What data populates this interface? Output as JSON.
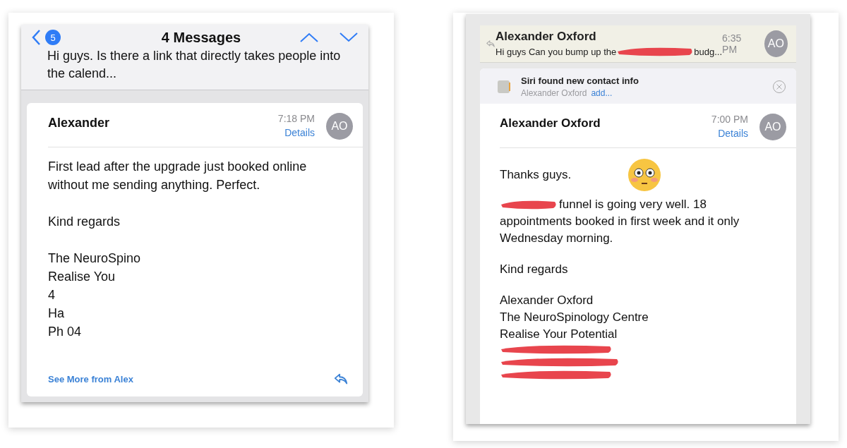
{
  "left": {
    "header": {
      "back_count": "5",
      "title": "4 Messages",
      "preview": "Hi guys. Is there a link that directly takes people into the calend..."
    },
    "message": {
      "sender": "Alexander",
      "time": "7:18 PM",
      "details": "Details",
      "avatar": "AO",
      "paragraphs": [
        [
          "First lead after the upgrade just booked online",
          "without me sending anything. Perfect."
        ],
        [
          "Kind regards"
        ],
        [
          "The NeuroSpino",
          "Realise You",
          "4",
          "Ha",
          "Ph 04"
        ]
      ],
      "see_more": "See More from Alex"
    }
  },
  "right": {
    "previous": {
      "sender": "Alexander Oxford",
      "preview_start": "Hi guys Can you bump up the",
      "preview_end": "budg...",
      "time": "6:35 PM",
      "avatar": "AO"
    },
    "siri": {
      "title": "Siri found new contact info",
      "name": "Alexander Oxford",
      "action": "add..."
    },
    "message": {
      "sender": "Alexander Oxford",
      "time": "7:00 PM",
      "details": "Details",
      "avatar": "AO",
      "greeting": "Thanks guys.",
      "paragraph": [
        {
          "kind": "redacted_start",
          "text": "funnel is going very well. 18"
        },
        {
          "kind": "text",
          "text": "appointments booked in first week and it only"
        },
        {
          "kind": "text",
          "text": "Wednesday morning."
        }
      ],
      "closing": "Kind regards",
      "signature": [
        {
          "kind": "text",
          "text": "Alexander Oxford"
        },
        {
          "kind": "text",
          "text": "The NeuroSpinology Centre"
        },
        {
          "kind": "text",
          "text": "Realise Your Potential"
        },
        {
          "kind": "redacted"
        },
        {
          "kind": "redacted"
        },
        {
          "kind": "redacted"
        }
      ]
    }
  }
}
